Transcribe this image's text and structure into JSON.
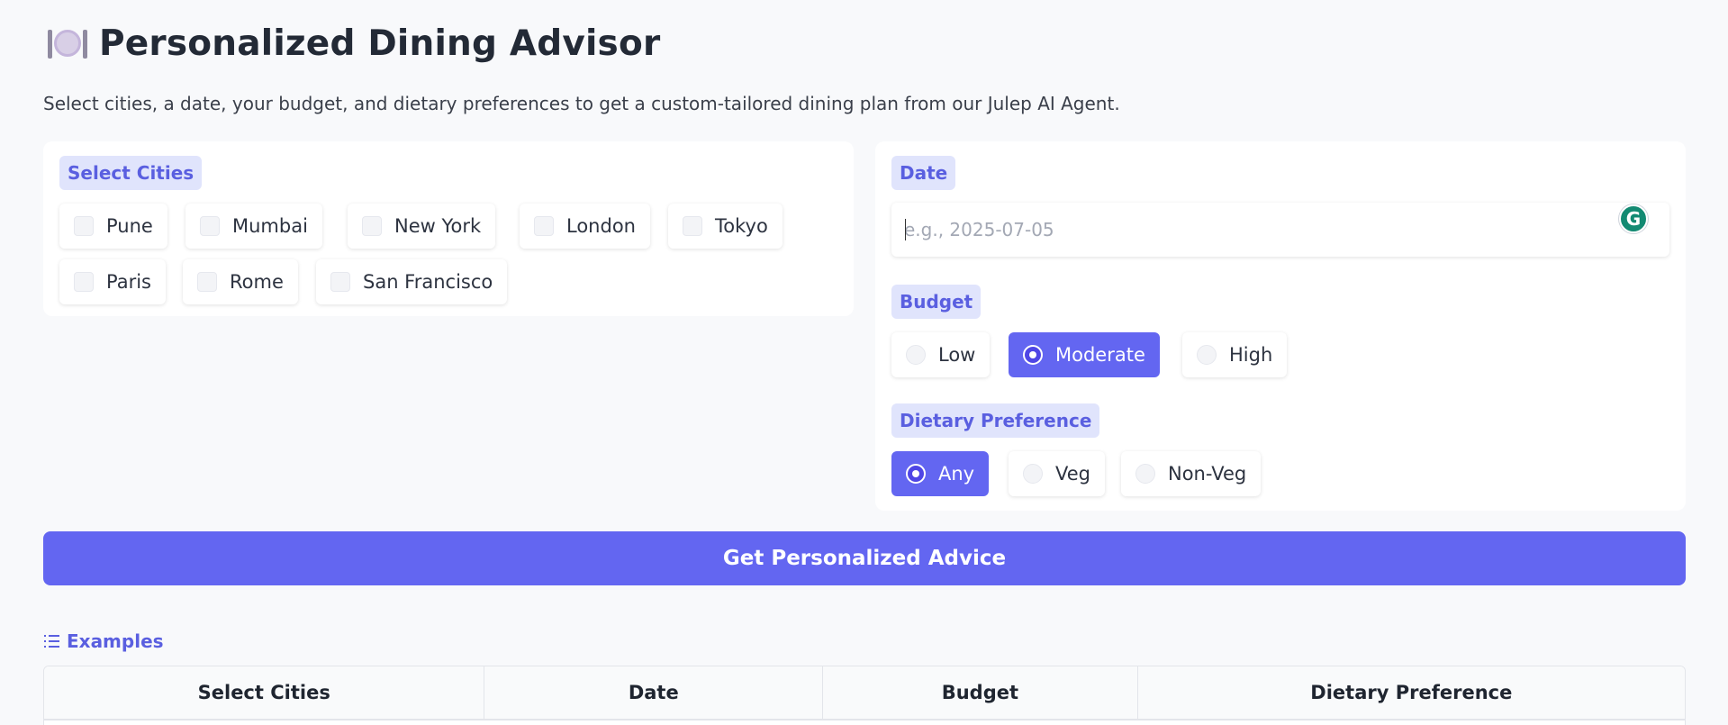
{
  "header": {
    "icon": "plate-cutlery-icon",
    "title": "Personalized Dining Advisor",
    "subtitle": "Select cities, a date, your budget, and dietary preferences to get a custom-tailored dining plan from our Julep AI Agent."
  },
  "cities": {
    "label": "Select Cities",
    "options": [
      "Pune",
      "Mumbai",
      "New York",
      "London",
      "Tokyo",
      "Paris",
      "Rome",
      "San Francisco"
    ],
    "checked": []
  },
  "date": {
    "label": "Date",
    "value": "",
    "placeholder": "e.g., 2025-07-05",
    "assistant_icon": "G"
  },
  "budget": {
    "label": "Budget",
    "options": [
      "Low",
      "Moderate",
      "High"
    ],
    "selected": "Moderate"
  },
  "diet": {
    "label": "Dietary Preference",
    "options": [
      "Any",
      "Veg",
      "Non-Veg"
    ],
    "selected": "Any"
  },
  "submit_label": "Get Personalized Advice",
  "examples": {
    "label": "Examples",
    "icon": "list-icon",
    "columns": [
      "Select Cities",
      "Date",
      "Budget",
      "Dietary Preference"
    ]
  },
  "colors": {
    "accent": "#6366f1",
    "label_bg": "#e0e4fc",
    "label_text": "#5a5fe0",
    "page_bg": "#f8f9fb"
  }
}
